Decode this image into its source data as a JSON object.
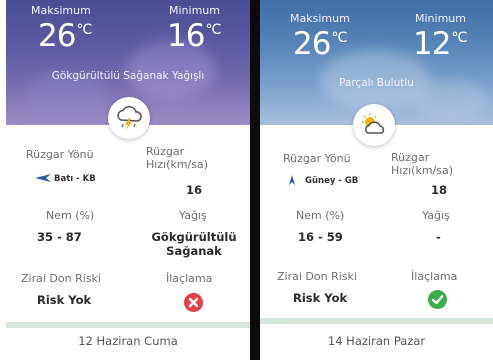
{
  "cards": [
    {
      "max_label": "Maksimum",
      "max_temp": "26",
      "min_label": "Minimum",
      "min_temp": "16",
      "unit": "°C",
      "condition": "Gökgürültülü Sağanak Yağışlı",
      "weather_icon": "thunderstorm-icon",
      "wind_direction_label": "Rüzgar Yönü",
      "wind_direction_value": "Batı - KB",
      "wind_speed_label": "Rüzgar Hızı(km/sa)",
      "wind_speed_value": "16",
      "humidity_label": "Nem (%)",
      "humidity_value": "35 - 87",
      "precip_label": "Yağış",
      "precip_value": "Gökgürültülü Sağanak",
      "frost_label": "Zirai Don Riski",
      "frost_value": "Risk Yok",
      "spray_label": "İlaçlama",
      "spray_status": "not-suitable",
      "spray_icon": "close-icon",
      "date": "12 Haziran Cuma"
    },
    {
      "max_label": "Maksimum",
      "max_temp": "26",
      "min_label": "Minimum",
      "min_temp": "12",
      "unit": "°C",
      "condition": "Parçalı Bulutlu",
      "weather_icon": "partly-cloudy-icon",
      "wind_direction_label": "Rüzgar Yönü",
      "wind_direction_value": "Güney - GB",
      "wind_speed_label": "Rüzgar Hızı(km/sa)",
      "wind_speed_value": "18",
      "humidity_label": "Nem (%)",
      "humidity_value": "16 - 59",
      "precip_label": "Yağış",
      "precip_value": "-",
      "frost_label": "Zirai Don Riski",
      "frost_value": "Risk Yok",
      "spray_label": "İlaçlama",
      "spray_status": "suitable",
      "spray_icon": "check-icon",
      "date": "14 Haziran Pazar"
    }
  ],
  "colors": {
    "storm_sky": "#5d5aa4",
    "cloudy_sky": "#5a88bc",
    "status_bad": "#e0424c",
    "status_good": "#3aae4b",
    "wind_arrow": "#2c57a8"
  }
}
